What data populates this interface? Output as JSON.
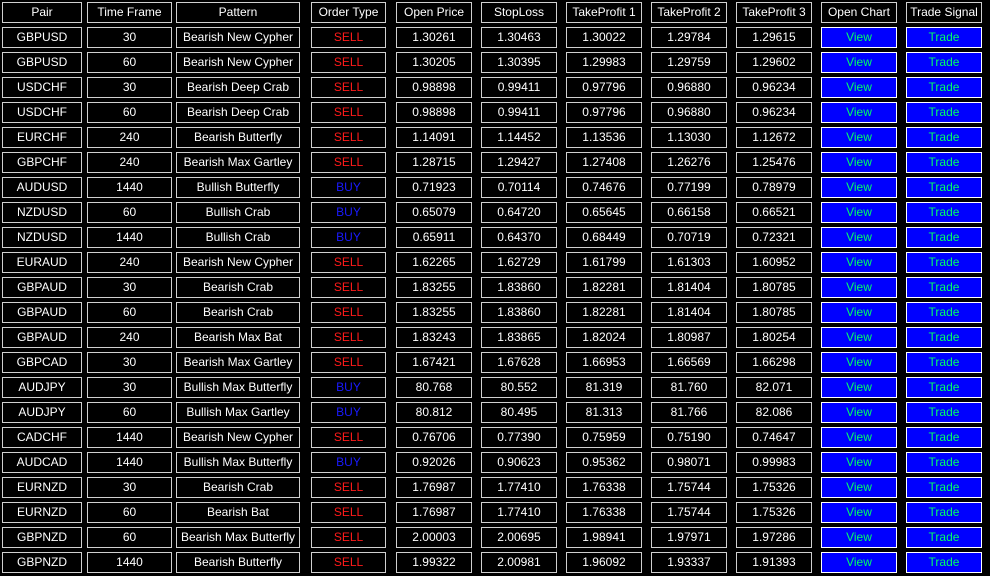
{
  "colors": {
    "background": "#000000",
    "cell_border": "#d0d0d0",
    "text": "#ffffff",
    "sell": "#ff1a1a",
    "buy": "#1a1aff",
    "button_bg": "#0000ff",
    "button_text": "#00ff66"
  },
  "headers": [
    "Pair",
    "Time Frame",
    "Pattern",
    "Order Type",
    "Open Price",
    "StopLoss",
    "TakeProfit 1",
    "TakeProfit 2",
    "TakeProfit 3",
    "Open Chart",
    "Trade Signal"
  ],
  "buttons": {
    "open_chart_label": "View",
    "trade_label": "Trade"
  },
  "rows": [
    {
      "pair": "GBPUSD",
      "timeframe": "30",
      "pattern": "Bearish New Cypher",
      "order": "SELL",
      "open": "1.30261",
      "sl": "1.30463",
      "tp1": "1.30022",
      "tp2": "1.29784",
      "tp3": "1.29615"
    },
    {
      "pair": "GBPUSD",
      "timeframe": "60",
      "pattern": "Bearish New Cypher",
      "order": "SELL",
      "open": "1.30205",
      "sl": "1.30395",
      "tp1": "1.29983",
      "tp2": "1.29759",
      "tp3": "1.29602"
    },
    {
      "pair": "USDCHF",
      "timeframe": "30",
      "pattern": "Bearish Deep Crab",
      "order": "SELL",
      "open": "0.98898",
      "sl": "0.99411",
      "tp1": "0.97796",
      "tp2": "0.96880",
      "tp3": "0.96234"
    },
    {
      "pair": "USDCHF",
      "timeframe": "60",
      "pattern": "Bearish Deep Crab",
      "order": "SELL",
      "open": "0.98898",
      "sl": "0.99411",
      "tp1": "0.97796",
      "tp2": "0.96880",
      "tp3": "0.96234"
    },
    {
      "pair": "EURCHF",
      "timeframe": "240",
      "pattern": "Bearish Butterfly",
      "order": "SELL",
      "open": "1.14091",
      "sl": "1.14452",
      "tp1": "1.13536",
      "tp2": "1.13030",
      "tp3": "1.12672"
    },
    {
      "pair": "GBPCHF",
      "timeframe": "240",
      "pattern": "Bearish Max Gartley",
      "order": "SELL",
      "open": "1.28715",
      "sl": "1.29427",
      "tp1": "1.27408",
      "tp2": "1.26276",
      "tp3": "1.25476"
    },
    {
      "pair": "AUDUSD",
      "timeframe": "1440",
      "pattern": "Bullish Butterfly",
      "order": "BUY",
      "open": "0.71923",
      "sl": "0.70114",
      "tp1": "0.74676",
      "tp2": "0.77199",
      "tp3": "0.78979"
    },
    {
      "pair": "NZDUSD",
      "timeframe": "60",
      "pattern": "Bullish Crab",
      "order": "BUY",
      "open": "0.65079",
      "sl": "0.64720",
      "tp1": "0.65645",
      "tp2": "0.66158",
      "tp3": "0.66521"
    },
    {
      "pair": "NZDUSD",
      "timeframe": "1440",
      "pattern": "Bullish Crab",
      "order": "BUY",
      "open": "0.65911",
      "sl": "0.64370",
      "tp1": "0.68449",
      "tp2": "0.70719",
      "tp3": "0.72321"
    },
    {
      "pair": "EURAUD",
      "timeframe": "240",
      "pattern": "Bearish New Cypher",
      "order": "SELL",
      "open": "1.62265",
      "sl": "1.62729",
      "tp1": "1.61799",
      "tp2": "1.61303",
      "tp3": "1.60952"
    },
    {
      "pair": "GBPAUD",
      "timeframe": "30",
      "pattern": "Bearish Crab",
      "order": "SELL",
      "open": "1.83255",
      "sl": "1.83860",
      "tp1": "1.82281",
      "tp2": "1.81404",
      "tp3": "1.80785"
    },
    {
      "pair": "GBPAUD",
      "timeframe": "60",
      "pattern": "Bearish Crab",
      "order": "SELL",
      "open": "1.83255",
      "sl": "1.83860",
      "tp1": "1.82281",
      "tp2": "1.81404",
      "tp3": "1.80785"
    },
    {
      "pair": "GBPAUD",
      "timeframe": "240",
      "pattern": "Bearish Max Bat",
      "order": "SELL",
      "open": "1.83243",
      "sl": "1.83865",
      "tp1": "1.82024",
      "tp2": "1.80987",
      "tp3": "1.80254"
    },
    {
      "pair": "GBPCAD",
      "timeframe": "30",
      "pattern": "Bearish Max Gartley",
      "order": "SELL",
      "open": "1.67421",
      "sl": "1.67628",
      "tp1": "1.66953",
      "tp2": "1.66569",
      "tp3": "1.66298"
    },
    {
      "pair": "AUDJPY",
      "timeframe": "30",
      "pattern": "Bullish Max Butterfly",
      "order": "BUY",
      "open": "80.768",
      "sl": "80.552",
      "tp1": "81.319",
      "tp2": "81.760",
      "tp3": "82.071"
    },
    {
      "pair": "AUDJPY",
      "timeframe": "60",
      "pattern": "Bullish Max Gartley",
      "order": "BUY",
      "open": "80.812",
      "sl": "80.495",
      "tp1": "81.313",
      "tp2": "81.766",
      "tp3": "82.086"
    },
    {
      "pair": "CADCHF",
      "timeframe": "1440",
      "pattern": "Bearish New Cypher",
      "order": "SELL",
      "open": "0.76706",
      "sl": "0.77390",
      "tp1": "0.75959",
      "tp2": "0.75190",
      "tp3": "0.74647"
    },
    {
      "pair": "AUDCAD",
      "timeframe": "1440",
      "pattern": "Bullish Max Butterfly",
      "order": "BUY",
      "open": "0.92026",
      "sl": "0.90623",
      "tp1": "0.95362",
      "tp2": "0.98071",
      "tp3": "0.99983"
    },
    {
      "pair": "EURNZD",
      "timeframe": "30",
      "pattern": "Bearish Crab",
      "order": "SELL",
      "open": "1.76987",
      "sl": "1.77410",
      "tp1": "1.76338",
      "tp2": "1.75744",
      "tp3": "1.75326"
    },
    {
      "pair": "EURNZD",
      "timeframe": "60",
      "pattern": "Bearish Bat",
      "order": "SELL",
      "open": "1.76987",
      "sl": "1.77410",
      "tp1": "1.76338",
      "tp2": "1.75744",
      "tp3": "1.75326"
    },
    {
      "pair": "GBPNZD",
      "timeframe": "60",
      "pattern": "Bearish Max Butterfly",
      "order": "SELL",
      "open": "2.00003",
      "sl": "2.00695",
      "tp1": "1.98941",
      "tp2": "1.97971",
      "tp3": "1.97286"
    },
    {
      "pair": "GBPNZD",
      "timeframe": "1440",
      "pattern": "Bearish Butterfly",
      "order": "SELL",
      "open": "1.99322",
      "sl": "2.00981",
      "tp1": "1.96092",
      "tp2": "1.93337",
      "tp3": "1.91393"
    }
  ]
}
